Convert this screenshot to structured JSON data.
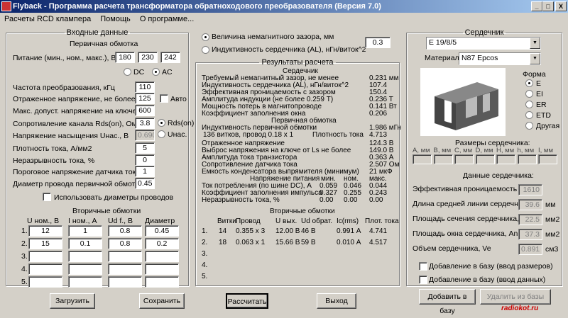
{
  "window": {
    "title": "Flyback - Программа расчета трансформатора обратноходового преобразователя (Версия 7.0)",
    "min": "_",
    "max": "□",
    "close": "X"
  },
  "menu": [
    "Расчеты RCD клампера",
    "Помощь",
    "О программе..."
  ],
  "input": {
    "legend": "Входные данные",
    "primary_title": "Первичная обмотка",
    "supply_label": "Питание (мин., ном., макс.), В",
    "supply": [
      "180",
      "230",
      "242"
    ],
    "dc": "DC",
    "ac": "AC",
    "freq_label": "Частота преобразования, кГц",
    "freq": "110",
    "refl_label": "Отраженное напряжение, не более, В",
    "refl": "125",
    "auto": "Авто",
    "vmax_label": "Макс. допуст. напряжение на ключе, В",
    "vmax": "600",
    "rds_label": "Сопротивление канала Rds(on), Ом",
    "rds": "3.8",
    "rds_opt": "Rds(on)",
    "usat_label": "Напряжение насыщения Uнас., В",
    "usat": "0.690",
    "usat_opt": "Uнас.",
    "jdens_label": "Плотность тока, А/мм2",
    "jdens": "5",
    "disc_label": "Неразрывность тока, %",
    "disc": "0",
    "sense_label": "Пороговое напряжение датчика тока, В",
    "sense": "1",
    "wire_label": "Диаметр провода первичной обмотки",
    "wire": "0.45",
    "use_diam": "Использовать диаметры проводов",
    "secondary_title": "Вторичные обмотки",
    "sec_headers": [
      "U ном., В",
      "I ном., А",
      "Ud f., В",
      "Диаметр"
    ],
    "sec_rows": [
      {
        "n": "1.",
        "u": "12",
        "i": "1",
        "ud": "0.8",
        "d": "0.45"
      },
      {
        "n": "2.",
        "u": "15",
        "i": "0.1",
        "ud": "0.8",
        "d": "0.2"
      },
      {
        "n": "3.",
        "u": "",
        "i": "",
        "ud": "",
        "d": ""
      },
      {
        "n": "4.",
        "u": "",
        "i": "",
        "ud": "",
        "d": ""
      },
      {
        "n": "5.",
        "u": "",
        "i": "",
        "ud": "",
        "d": ""
      }
    ]
  },
  "gap": {
    "opt1": "Величина немагнитного зазора, мм",
    "opt2": "Индуктивность сердечника (AL), нГн/виток^2",
    "value": "0.3"
  },
  "results": {
    "legend": "Результаты расчета",
    "core_title": "Сердечник",
    "core_rows": [
      [
        "Требуемый немагнитный зазор, не менее",
        "0.231 мм"
      ],
      [
        "Индуктивность сердечника (AL), нГн/виток^2",
        "107.4"
      ],
      [
        "Эффективная проницаемость с зазором",
        "150.4"
      ],
      [
        "Амплитуда индукции               (не более 0.259 Т)",
        "0.236 Т"
      ],
      [
        "Мощность потерь в магнитопроводе",
        "0.141 Вт"
      ],
      [
        "Коэффициент заполнения окна",
        "0.206"
      ]
    ],
    "primary_title": "Первичная обмотка",
    "prim_row0": [
      "Индуктивность первичной обмотки",
      "1.986 мГн"
    ],
    "prim_row1": [
      "136 витков, провод 0.18 x 1",
      "Плотность тока",
      "4.713"
    ],
    "prim_rows": [
      [
        "Отраженное напряжение",
        "124.3 В"
      ],
      [
        "Выброс напряжения на ключе от Ls не более",
        "149.0 В"
      ],
      [
        "Амплитуда тока транзистора",
        "0.363 А"
      ],
      [
        "Сопротивление датчика тока",
        "2.507 Ом"
      ],
      [
        "Емкость конденсатора выпрямителя (минимум)",
        "21 мкФ"
      ]
    ],
    "supply_hdr": [
      "Напряжение питания",
      "мин.",
      "ном.",
      "макс."
    ],
    "supply_rows": [
      [
        "Ток потребления (по шине DC), А",
        "0.059",
        "0.046",
        "0.044"
      ],
      [
        "Коэффициент заполнения импульса",
        "0.327",
        "0.255",
        "0.243"
      ],
      [
        "Неразрывность тока, %",
        "0.00",
        "0.00",
        "0.00"
      ]
    ],
    "sec_title": "Вторичные обмотки",
    "sec_headers": [
      "Витки",
      "Провод",
      "U вых.",
      "Ud обрат.",
      "Ic(rms)",
      "Плот. тока"
    ],
    "sec_rows": [
      [
        "1.",
        "14",
        "0.355 x 3",
        "12.00 В",
        "46 В",
        "0.991 А",
        "4.741"
      ],
      [
        "2.",
        "18",
        "0.063 x 1",
        "15.66 В",
        "59 В",
        "0.010 А",
        "4.517"
      ],
      [
        "3.",
        "",
        "",
        "",
        "",
        "",
        ""
      ],
      [
        "4.",
        "",
        "",
        "",
        "",
        "",
        ""
      ],
      [
        "5.",
        "",
        "",
        "",
        "",
        "",
        ""
      ]
    ]
  },
  "core": {
    "legend": "Сердечник",
    "type": "E 19/8/5",
    "material_label": "Материал:",
    "material": "N87 Epcos",
    "shape_title": "Форма",
    "shapes": [
      "E",
      "EI",
      "ER",
      "ETD",
      "Другая"
    ],
    "dims_title": "Размеры сердечника:",
    "dims": [
      "A, мм",
      "B, мм",
      "C, мм",
      "D, мм",
      "H, мм",
      "h, мм",
      "I, мм"
    ],
    "data_title": "Данные сердечника:",
    "data_rows": [
      {
        "label": "Эффективная проницаемость",
        "value": "1610",
        "unit": ""
      },
      {
        "label": "Длина средней линии сердечника, le",
        "value": "39.6",
        "unit": "мм"
      },
      {
        "label": "Площадь сечения сердечника, Ae",
        "value": "22.5",
        "unit": "мм2"
      },
      {
        "label": "Площадь окна сердечника, An",
        "value": "37.3",
        "unit": "мм2"
      },
      {
        "label": "Объем сердечника, Ve",
        "value": "0.891",
        "unit": "см3"
      }
    ],
    "add_sizes": "Добавление в базу (ввод размеров)",
    "add_data": "Добавление в базу (ввод данных)",
    "add_btn": "Добавить в базу",
    "del_btn": "Удалить из базы"
  },
  "buttons": {
    "load": "Загрузить",
    "save": "Сохранить",
    "calc": "Рассчитать",
    "exit": "Выход"
  },
  "watermark": "radiokot.ru"
}
